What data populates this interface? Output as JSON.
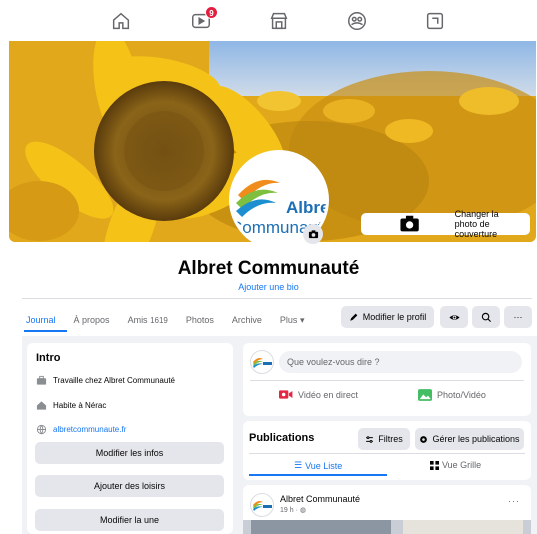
{
  "colors": {
    "accent": "#1877f2",
    "badge": "#e41e3f",
    "gray_button": "#e4e6eb",
    "page_bg": "#f0f2f5"
  },
  "top_nav": {
    "icons": [
      "home-icon",
      "video-icon",
      "marketplace-icon",
      "groups-icon",
      "gaming-icon"
    ],
    "video_badge": "9"
  },
  "cover": {
    "change_cover_label": "Changer la photo de couverture"
  },
  "profile": {
    "logo_text_1": "Albret",
    "logo_text_2": "Communauté",
    "name": "Albret Communauté",
    "add_bio": "Ajouter une bio"
  },
  "tabs": {
    "journal": "Journal",
    "apropos": "À propos",
    "amis": "Amis",
    "amis_count": "1619",
    "photos": "Photos",
    "archive": "Archive",
    "plus": "Plus"
  },
  "profile_actions": {
    "edit_profile": "Modifier le profil",
    "more": "···"
  },
  "intro": {
    "title": "Intro",
    "work_prefix": "Travaille chez",
    "work_place": "Albret Communauté",
    "lives_prefix": "Habite à",
    "lives_place": "Nérac",
    "website": "albretcommunaute.fr",
    "edit_info": "Modifier les infos",
    "add_hobbies": "Ajouter des loisirs",
    "edit_featured": "Modifier la une"
  },
  "composer": {
    "placeholder": "Que voulez-vous dire ?",
    "live_video": "Vidéo en direct",
    "photo_video": "Photo/Vidéo"
  },
  "publications": {
    "title": "Publications",
    "filters": "Filtres",
    "manage": "Gérer les publications",
    "list_view": "Vue Liste",
    "grid_view": "Vue Grille"
  },
  "post": {
    "author": "Albret Communauté",
    "time": "19 h ·",
    "more": "···"
  }
}
